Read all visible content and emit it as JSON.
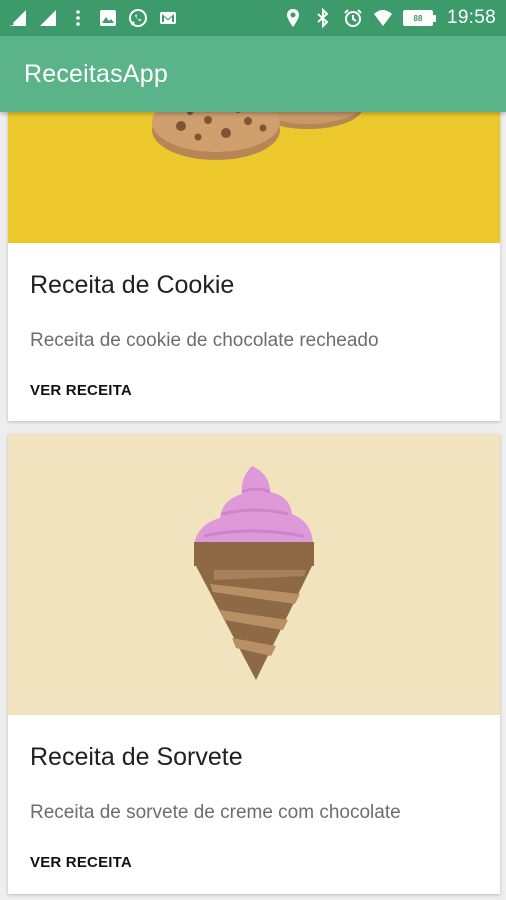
{
  "status_bar": {
    "time": "19:58",
    "battery": "88",
    "icons_left": [
      "signal-icon",
      "signal-icon",
      "more-vert-icon",
      "image-icon",
      "whatsapp-icon",
      "gmail-icon"
    ],
    "icons_right": [
      "location-icon",
      "bluetooth-icon",
      "alarm-icon",
      "wifi-icon",
      "battery-icon"
    ]
  },
  "app_bar": {
    "title": "ReceitasApp"
  },
  "colors": {
    "status_bar": "#3d9a6a",
    "app_bar": "#5bb38a",
    "cookie_bg": "#edc82c",
    "icecream_bg": "#f1e3bd",
    "icecream_scoop": "#de99d8",
    "cone": "#8d6a45"
  },
  "recipes": [
    {
      "title": "Receita de Cookie",
      "description": "Receita de cookie de chocolate recheado",
      "action": "VER RECEITA",
      "image": "cookies-image"
    },
    {
      "title": "Receita de Sorvete",
      "description": "Receita de sorvete de creme com chocolate",
      "action": "VER RECEITA",
      "image": "ice-cream-image"
    }
  ]
}
